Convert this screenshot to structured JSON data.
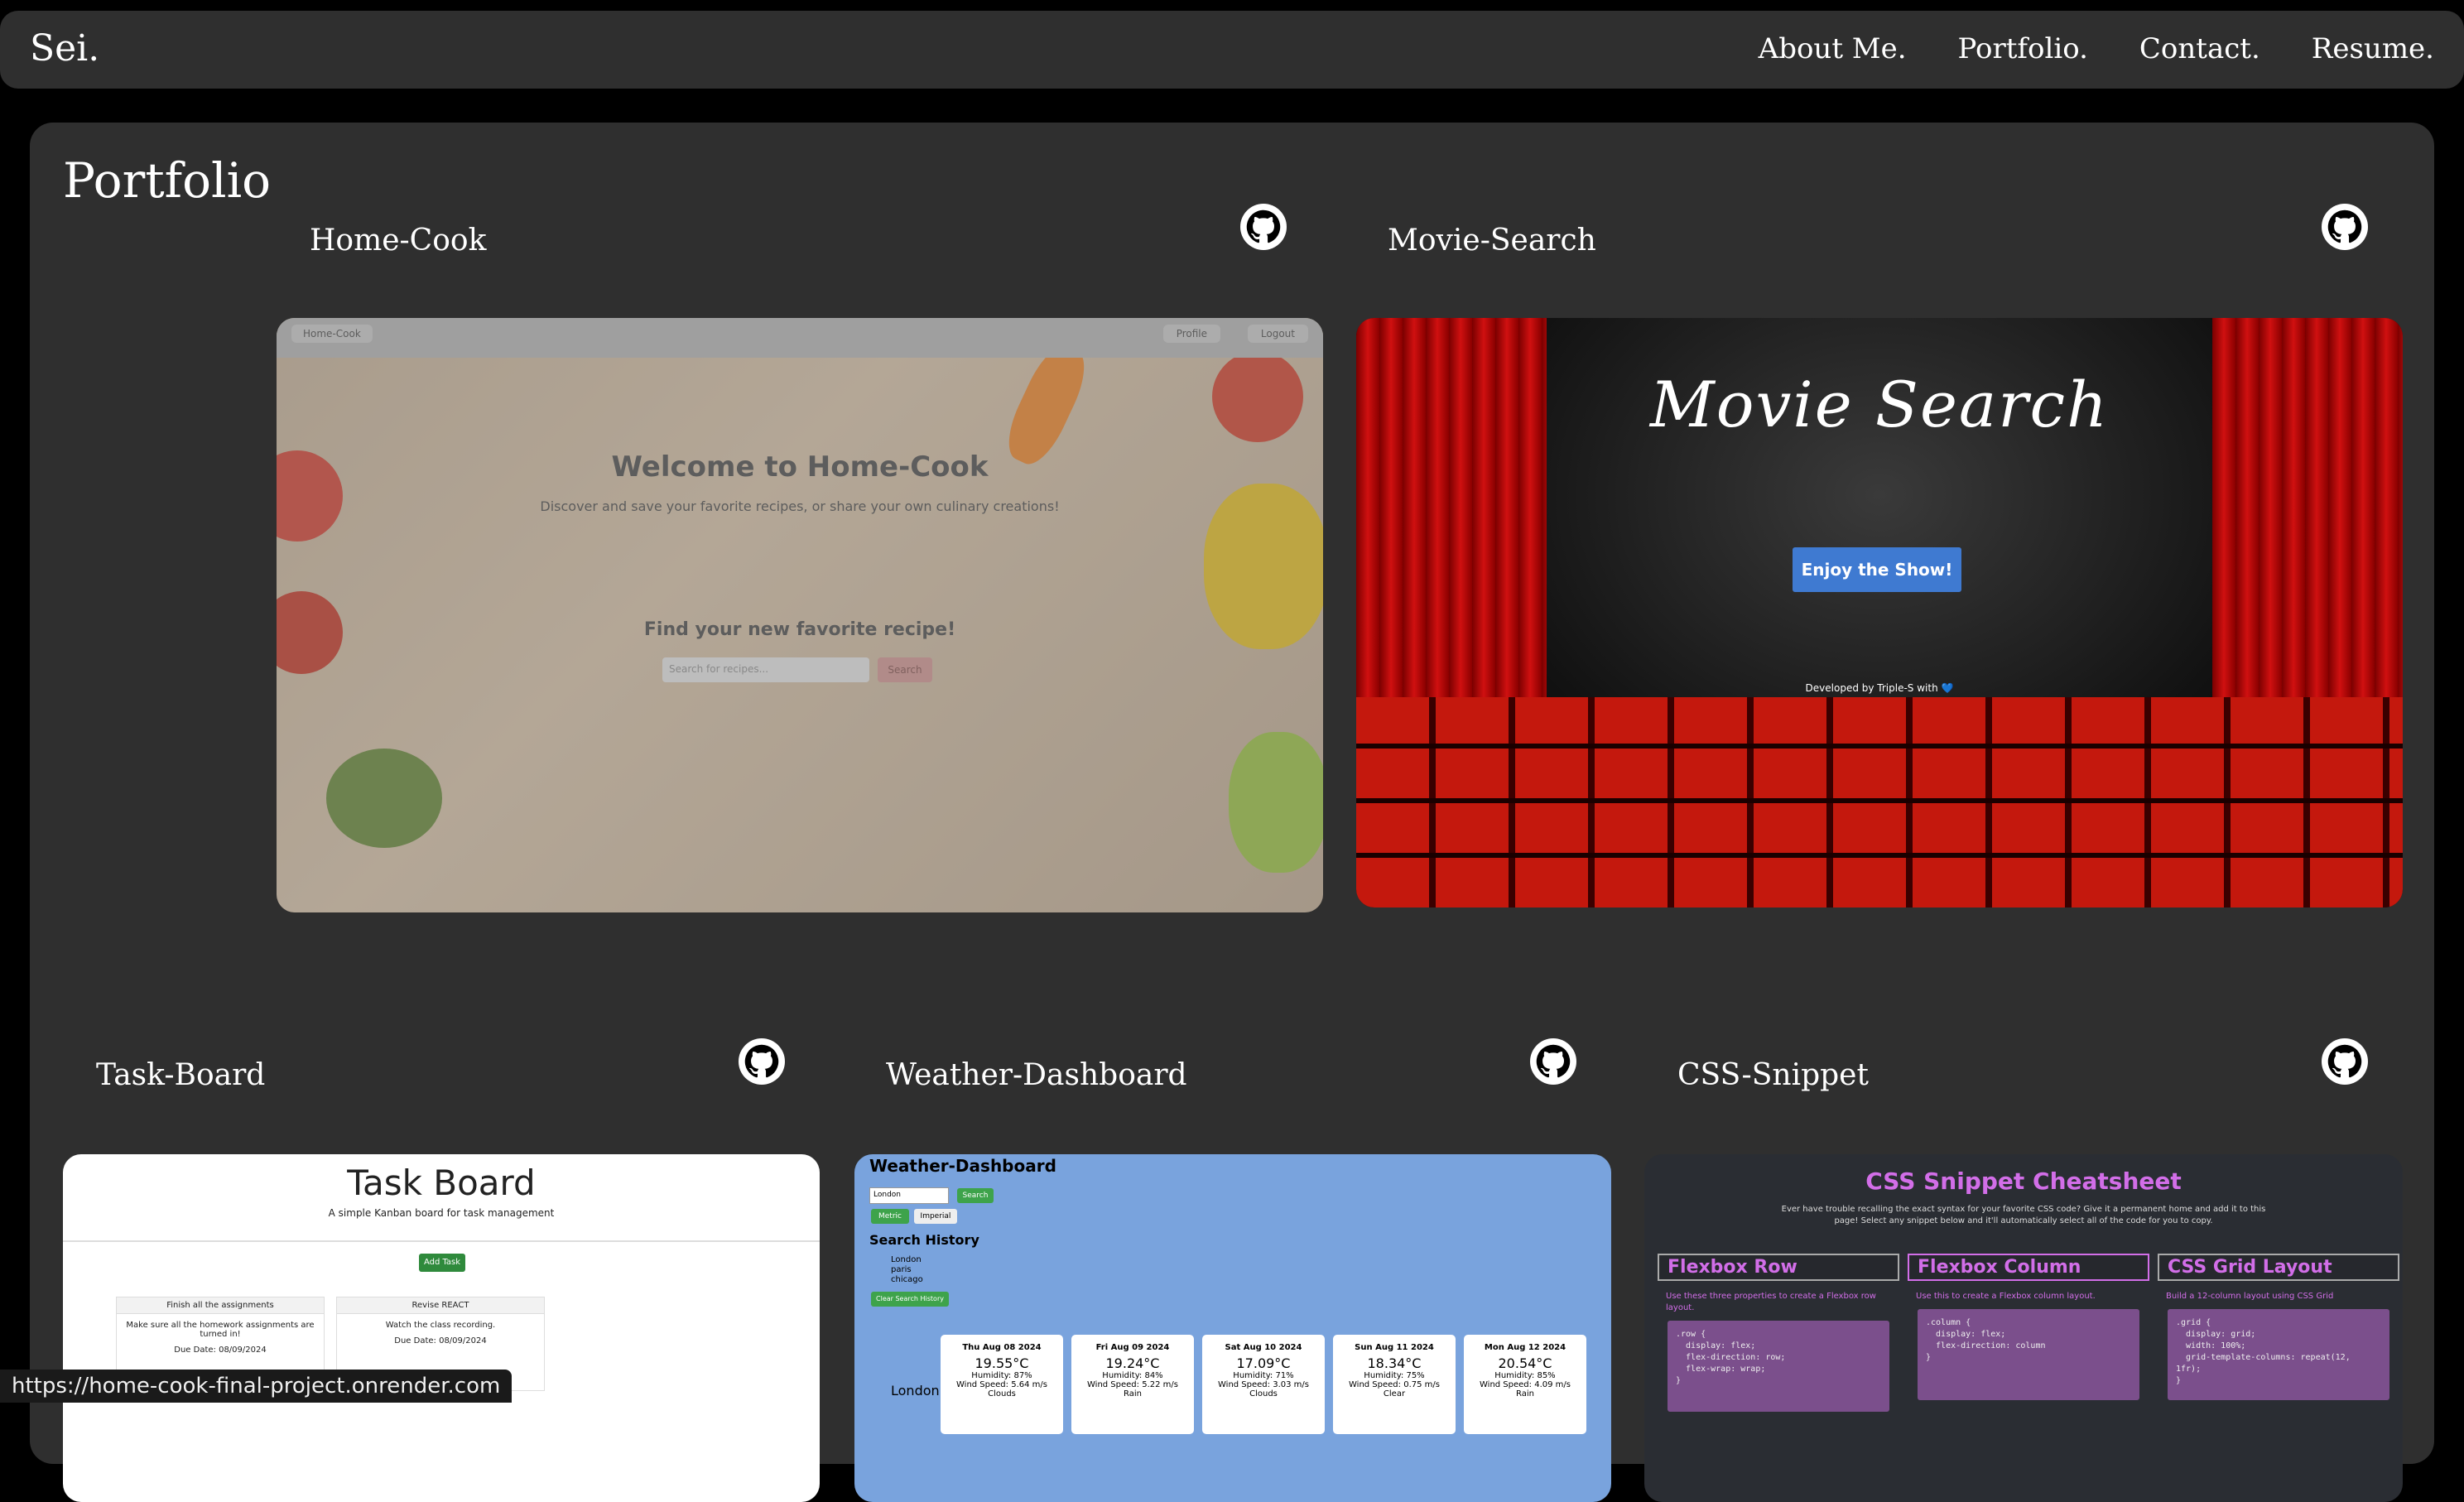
{
  "navbar": {
    "brand": "Sei.",
    "links": [
      "About Me.",
      "Portfolio.",
      "Contact.",
      "Resume."
    ]
  },
  "portfolio": {
    "title": "Portfolio",
    "projects": [
      {
        "name": "Home-Cook",
        "icon": "github-icon",
        "preview": {
          "nav_brand": "Home-Cook",
          "profile": "Profile",
          "logout": "Logout",
          "heading": "Welcome to Home-Cook",
          "subheading": "Discover and save your favorite recipes, or share your own culinary creations!",
          "find_heading": "Find your new favorite recipe!",
          "search_placeholder": "Search for recipes...",
          "search_button": "Search"
        }
      },
      {
        "name": "Movie-Search",
        "icon": "github-icon",
        "preview": {
          "heading": "Movie Search",
          "button": "Enjoy the Show!",
          "footer": "Developed by Triple-S with 💙"
        }
      },
      {
        "name": "Task-Board",
        "icon": "github-icon",
        "preview": {
          "heading": "Task Board",
          "subheading": "A simple Kanban board for task management",
          "add_button": "Add Task",
          "cards": [
            {
              "title": "Finish all the assignments",
              "body": "Make sure all the homework assignments are turned in!",
              "due": "Due Date: 08/09/2024"
            },
            {
              "title": "Revise REACT",
              "body": "Watch the class recording.",
              "due": "Due Date: 08/09/2024"
            }
          ]
        }
      },
      {
        "name": "Weather-Dashboard",
        "icon": "github-icon",
        "preview": {
          "heading": "Weather-Dashboard",
          "input_value": "London",
          "search_button": "Search",
          "metric": "Metric",
          "imperial": "Imperial",
          "history_heading": "Search History",
          "history": [
            "London",
            "paris",
            "chicago"
          ],
          "clear_button": "Clear Search History",
          "city": "London",
          "forecast": [
            {
              "date": "Thu Aug 08 2024",
              "temp": "19.55°C",
              "humidity": "Humidity: 87%",
              "wind": "Wind Speed: 5.64 m/s",
              "desc": "Clouds"
            },
            {
              "date": "Fri Aug 09 2024",
              "temp": "19.24°C",
              "humidity": "Humidity: 84%",
              "wind": "Wind Speed: 5.22 m/s",
              "desc": "Rain"
            },
            {
              "date": "Sat Aug 10 2024",
              "temp": "17.09°C",
              "humidity": "Humidity: 71%",
              "wind": "Wind Speed: 3.03 m/s",
              "desc": "Clouds"
            },
            {
              "date": "Sun Aug 11 2024",
              "temp": "18.34°C",
              "humidity": "Humidity: 75%",
              "wind": "Wind Speed: 0.75 m/s",
              "desc": "Clear"
            },
            {
              "date": "Mon Aug 12 2024",
              "temp": "20.54°C",
              "humidity": "Humidity: 85%",
              "wind": "Wind Speed: 4.09 m/s",
              "desc": "Rain"
            }
          ]
        }
      },
      {
        "name": "CSS-Snippet",
        "icon": "github-icon",
        "preview": {
          "heading": "CSS Snippet Cheatsheet",
          "description": "Ever have trouble recalling the exact syntax for your favorite CSS code? Give it a permanent home and add it to this page! Select any snippet below and it'll automatically select all of the code for you to copy.",
          "snippets": [
            {
              "title": "Flexbox Row",
              "desc": "Use these three properties to create a Flexbox row layout.",
              "code": ".row {\n  display: flex;\n  flex-direction: row;\n  flex-wrap: wrap;\n}"
            },
            {
              "title": "Flexbox Column",
              "desc": "Use this to create a Flexbox column layout.",
              "code": ".column {\n  display: flex;\n  flex-direction: column\n}"
            },
            {
              "title": "CSS Grid Layout",
              "desc": "Build a 12-column layout using CSS Grid",
              "code": ".grid {\n  display: grid;\n  width: 100%;\n  grid-template-columns: repeat(12,\n1fr);\n}"
            }
          ]
        }
      }
    ]
  },
  "status_bar": {
    "url": "https://home-cook-final-project.onrender.com"
  }
}
